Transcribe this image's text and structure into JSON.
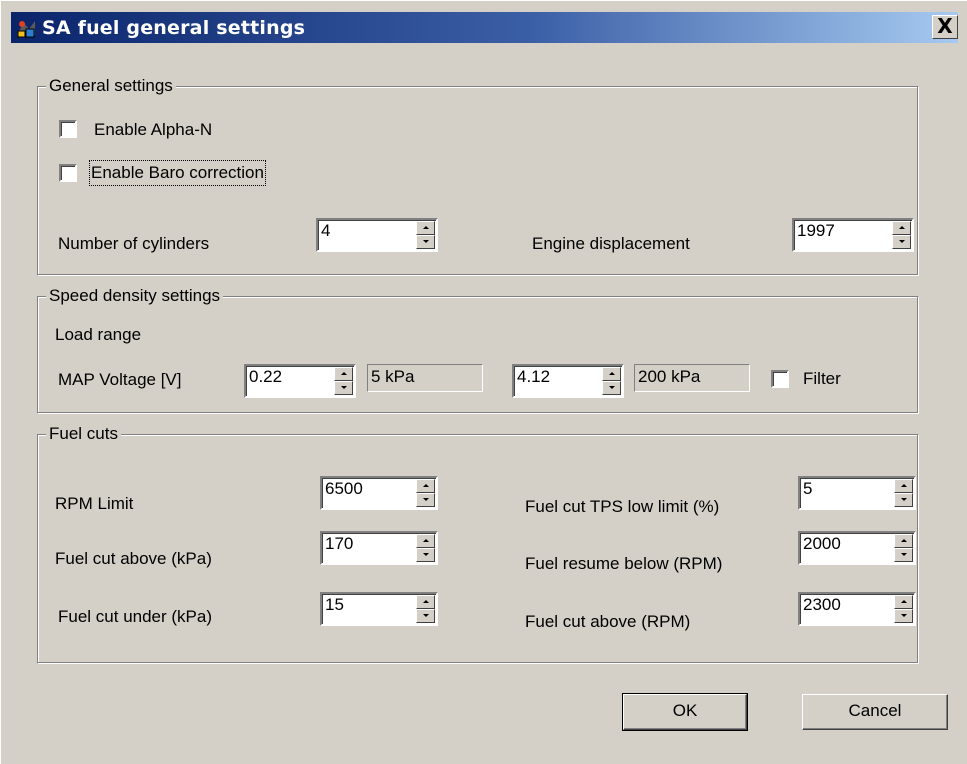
{
  "window": {
    "title": "SA fuel general settings",
    "close_label": "X"
  },
  "general": {
    "group_label": "General settings",
    "alpha_n_label": "Enable Alpha-N",
    "alpha_n_checked": false,
    "baro_label": "Enable Baro correction",
    "baro_checked": false,
    "cylinders_label": "Number of cylinders",
    "cylinders_value": "4",
    "displacement_label": "Engine displacement",
    "displacement_value": "1997"
  },
  "speed_density": {
    "group_label": "Speed density settings",
    "load_range_label": "Load range",
    "map_voltage_label": "MAP Voltage [V]",
    "min_voltage": "0.22",
    "min_kpa": "5 kPa",
    "max_voltage": "4.12",
    "max_kpa": "200 kPa",
    "filter_label": "Filter",
    "filter_checked": false
  },
  "fuel_cuts": {
    "group_label": "Fuel cuts",
    "rpm_limit_label": "RPM Limit",
    "rpm_limit_value": "6500",
    "cut_above_kpa_label": "Fuel cut above (kPa)",
    "cut_above_kpa_value": "170",
    "cut_under_kpa_label": "Fuel cut under (kPa)",
    "cut_under_kpa_value": "15",
    "tps_low_label": "Fuel cut TPS low limit (%)",
    "tps_low_value": "5",
    "resume_below_label": "Fuel resume below (RPM)",
    "resume_below_value": "2000",
    "cut_above_rpm_label": "Fuel cut above (RPM)",
    "cut_above_rpm_value": "2300"
  },
  "buttons": {
    "ok": "OK",
    "cancel": "Cancel"
  }
}
